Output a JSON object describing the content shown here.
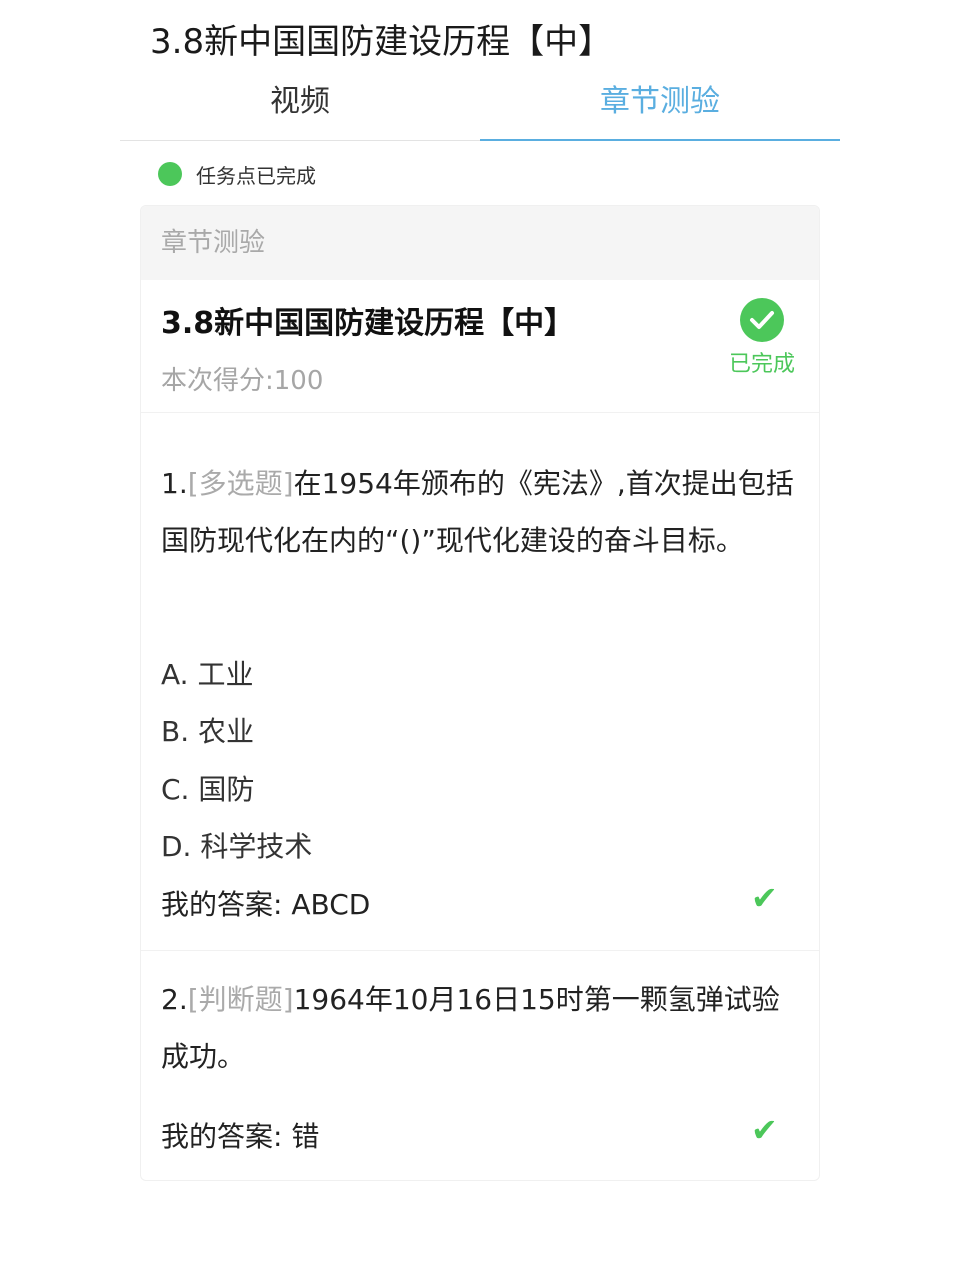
{
  "page": {
    "title": "3.8新中国国防建设历程【中】"
  },
  "tabs": [
    {
      "label": "视频"
    },
    {
      "label": "章节测验"
    }
  ],
  "status": {
    "text": "任务点已完成"
  },
  "card": {
    "header": "章节测验",
    "quiz_title": "3.8新中国国防建设历程【中】",
    "score": "本次得分:100",
    "done_label": "已完成",
    "answer_label": "我的答案:",
    "questions": [
      {
        "number": "1.",
        "type": "[多选题]",
        "text": "在1954年颁布的《宪法》,首次提出包括国防现代化在内的“()”现代化建设的奋斗目标。",
        "options": [
          "A. 工业",
          "B. 农业",
          "C. 国防",
          "D. 科学技术"
        ],
        "answer": "ABCD",
        "correct_mark": "✔"
      },
      {
        "number": "2.",
        "type": "[判断题]",
        "text": "1964年10月16日15时第一颗氢弹试验成功。",
        "answer": "错",
        "correct_mark": "✔"
      }
    ]
  },
  "colors": {
    "accent": "#5aaee0",
    "success": "#4cc75a",
    "muted": "#a6a6a6"
  }
}
